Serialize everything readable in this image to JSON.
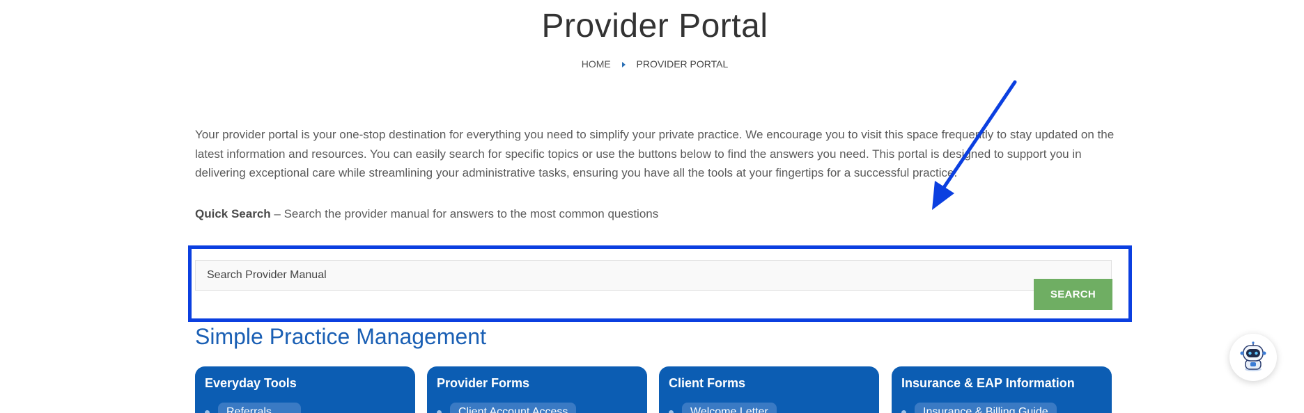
{
  "header": {
    "title": "Provider Portal",
    "breadcrumb": {
      "home": "HOME",
      "current": "PROVIDER PORTAL"
    }
  },
  "intro": {
    "paragraph": "Your provider portal is your one-stop destination for everything you need to simplify your private practice. We encourage you to visit this space frequently to stay updated on the latest information and resources. You can easily search for specific topics or use the buttons below to find the answers you need. This portal is designed to support you in delivering exceptional care while streamlining your administrative tasks, ensuring you have all the tools at your fingertips for a successful practice."
  },
  "quick_search": {
    "label_bold": "Quick Search",
    "label_rest": " – Search the provider manual for answers to the most common questions",
    "input_placeholder": "Search Provider Manual",
    "input_value": "",
    "button_label": "SEARCH"
  },
  "section": {
    "heading": "Simple Practice Management"
  },
  "cards": [
    {
      "title": "Everyday Tools",
      "first_item": "Referrals"
    },
    {
      "title": "Provider Forms",
      "first_item": "Client Account Access"
    },
    {
      "title": "Client Forms",
      "first_item": "Welcome Letter"
    },
    {
      "title": "Insurance & EAP Information",
      "first_item": "Insurance & Billing Guide"
    }
  ],
  "annotation": {
    "highlight_color": "#0b3fe0",
    "arrow_color": "#0b3fe0"
  },
  "colors": {
    "card_blue": "#0c5db3",
    "search_green": "#6fae63",
    "heading_blue": "#1a5fb4"
  },
  "icons": {
    "chatbot": "robot-icon",
    "breadcrumb_separator": "triangle-right-icon"
  }
}
